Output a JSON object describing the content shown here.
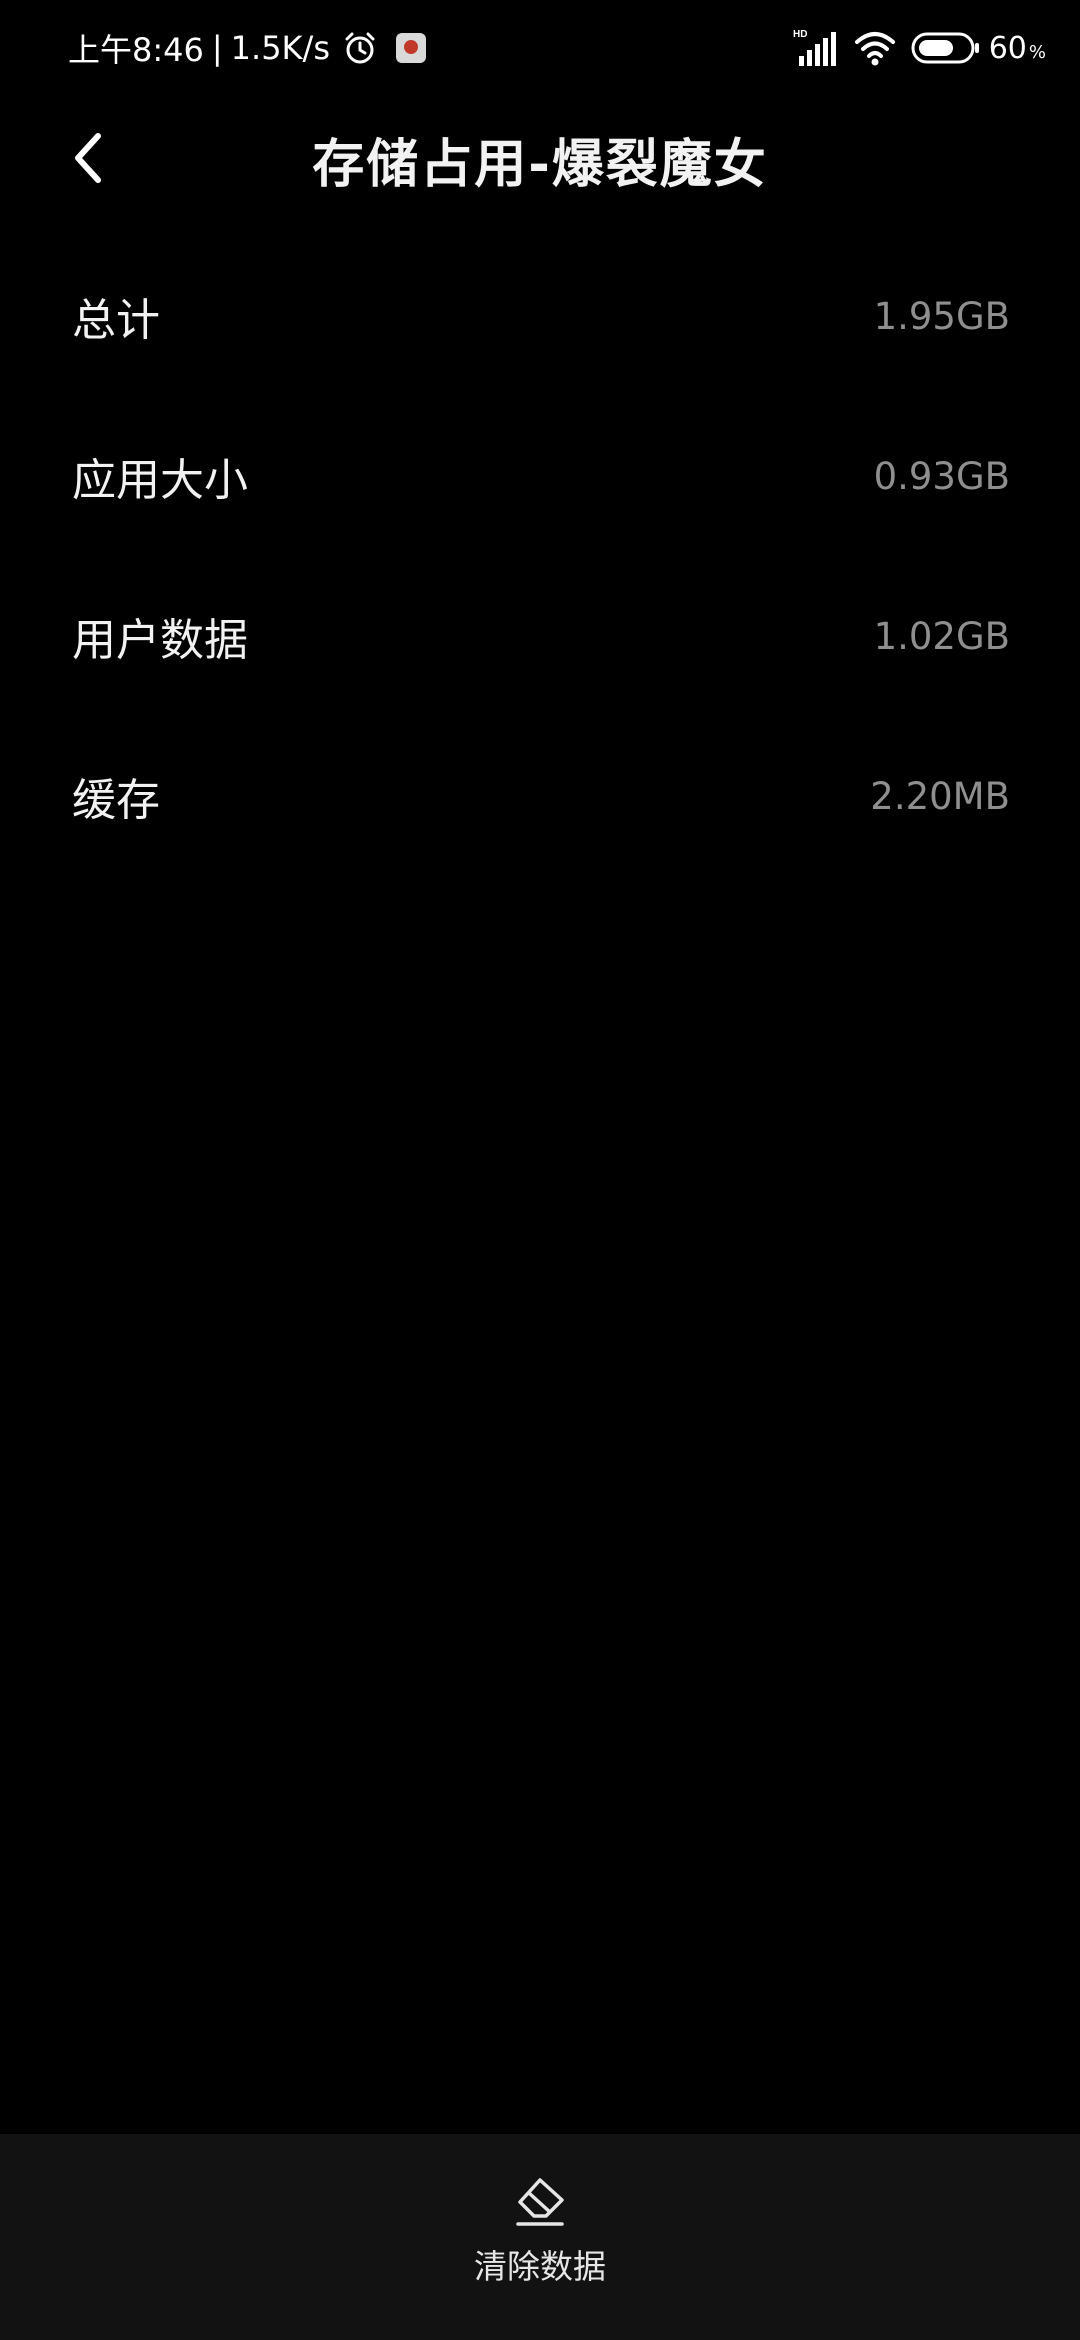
{
  "status_bar": {
    "time": "上午8:46",
    "separator": "|",
    "net_speed": "1.5K/s",
    "network_badge": "HD",
    "battery_level": "60",
    "battery_unit": "%",
    "icons": [
      "alarm-icon",
      "app-notification-icon",
      "signal-icon",
      "wifi-icon",
      "battery-icon"
    ]
  },
  "header": {
    "title": "存储占用-爆裂魔女",
    "back_icon": "chevron-left-icon"
  },
  "storage": {
    "items": [
      {
        "label": "总计",
        "value": "1.95GB"
      },
      {
        "label": "应用大小",
        "value": "0.93GB"
      },
      {
        "label": "用户数据",
        "value": "1.02GB"
      },
      {
        "label": "缓存",
        "value": "2.20MB"
      }
    ]
  },
  "bottom_bar": {
    "clear_label": "清除数据",
    "clear_icon": "eraser-icon"
  },
  "colors": {
    "background": "#000000",
    "bottom_bar": "#121212",
    "primary_text": "#f2f2f2",
    "secondary_text": "#8f8f8f"
  }
}
